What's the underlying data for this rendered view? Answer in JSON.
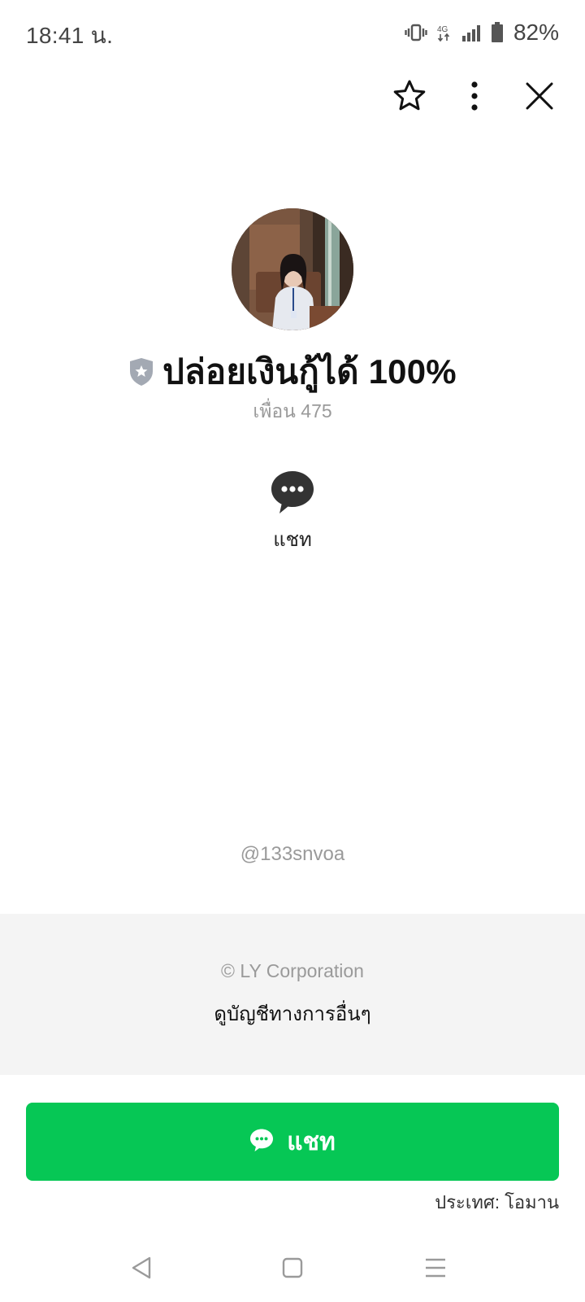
{
  "status_bar": {
    "time": "18:41 น.",
    "network": "4G",
    "battery": "82%",
    "icons": [
      "vibrate-icon",
      "network-4g-icon",
      "signal-icon",
      "battery-icon"
    ]
  },
  "top_actions": {
    "icons": [
      "star-icon",
      "more-vert-icon",
      "close-icon"
    ]
  },
  "profile": {
    "name": "ปล่อยเงินกู้ได้ 100%",
    "friends": "เพื่อน 475",
    "badge_icon": "shield-star-icon"
  },
  "actions": {
    "chat_label": "แชท"
  },
  "account_id": "@133snvoa",
  "footer": {
    "copyright": "© LY Corporation",
    "official_accounts_link": "ดูบัญชีทางการอื่นๆ"
  },
  "cta": {
    "label": "แชท",
    "color": "#06c755"
  },
  "country": "ประเทศ: โอมาน",
  "nav_bar": {
    "icons": [
      "back-icon",
      "home-icon",
      "recents-icon"
    ]
  },
  "colors": {
    "icon_dark": "#333333",
    "muted_text": "#9a9a9a",
    "footer_bg": "#f4f4f4"
  }
}
